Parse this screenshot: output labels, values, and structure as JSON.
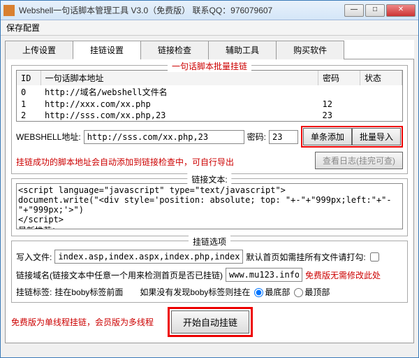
{
  "title": "Webshell一句话脚本管理工具 V3.0（免费版）    联系QQ：976079607",
  "menu": {
    "save": "保存配置"
  },
  "tabs": [
    "上传设置",
    "挂链设置",
    "链接检查",
    "辅助工具",
    "购买软件"
  ],
  "group_batch": {
    "title": "一句话脚本批量挂链",
    "cols": {
      "id": "ID",
      "addr": "一句话脚本地址",
      "pwd": "密码",
      "status": "状态"
    },
    "rows": [
      {
        "id": "0",
        "addr": "http://域名/webshell文件名",
        "pwd": "",
        "status": ""
      },
      {
        "id": "1",
        "addr": "http://xxx.com/xx.php",
        "pwd": "12",
        "status": ""
      },
      {
        "id": "2",
        "addr": "http://sss.com/xx.php,23",
        "pwd": "23",
        "status": ""
      }
    ],
    "addr_label": "WEBSHELL地址:",
    "addr_value": "http://sss.com/xx.php,23",
    "pwd_label": "密码:",
    "pwd_value": "23",
    "add_single": "单条添加",
    "add_batch": "批量导入",
    "hint": "挂链成功的脚本地址会自动添加到链接检查中，可自行导出",
    "log_btn": "查看日志(挂完可查)"
  },
  "group_text": {
    "title": "链接文本:",
    "script": "<script language=\"javascript\" type=\"text/javascript\">\ndocument.write(\"<div style='position: absolute; top: \"+-\"+\"999px;left:\"+\"-\"+\"999px;'>\")\n</script>\n最新推荐："
  },
  "group_opts": {
    "title": "挂链选项",
    "write_label": "写入文件:",
    "write_value": "index.asp,index.aspx,index.php,index.jsp,i",
    "default_label": "默认首页如需挂所有文件请打勾:",
    "domain_label": "链接域名(链接文本中任意一个用来检测首页是否已挂链)",
    "domain_value": "www.mu123.info",
    "domain_hint": "免费版无需修改此处",
    "tag_label": "挂链标签:",
    "tag_before": "挂在boby标签前面",
    "tag_mid": "如果没有发现boby标签则挂在",
    "opt_bottom": "最底部",
    "opt_top": "最顶部"
  },
  "footer": {
    "note": "免费版为单线程挂链，会员版为多线程",
    "start": "开始自动挂链"
  }
}
